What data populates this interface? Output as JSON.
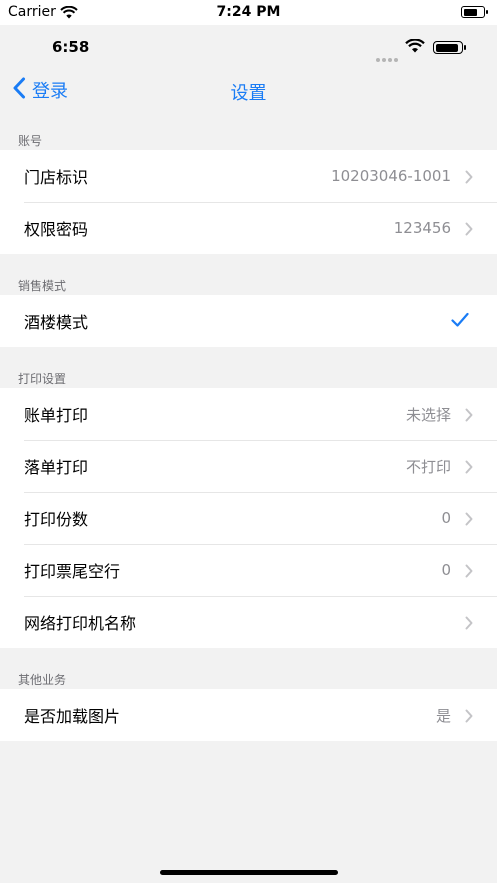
{
  "simulator_status": {
    "carrier": "Carrier",
    "time": "7:24 PM"
  },
  "device_status": {
    "time": "6:58"
  },
  "nav": {
    "back_label": "登录",
    "title": "设置"
  },
  "accent_color": "#1a7cf5",
  "sections": [
    {
      "header": "账号",
      "rows": [
        {
          "label": "门店标识",
          "value": "10203046-1001",
          "accessory": "chevron-icon"
        },
        {
          "label": "权限密码",
          "value": "123456",
          "accessory": "chevron-icon"
        }
      ]
    },
    {
      "header": "销售模式",
      "rows": [
        {
          "label": "酒楼模式",
          "value": "",
          "accessory": "checkmark-icon"
        }
      ]
    },
    {
      "header": "打印设置",
      "rows": [
        {
          "label": "账单打印",
          "value": "未选择",
          "accessory": "chevron-icon"
        },
        {
          "label": "落单打印",
          "value": "不打印",
          "accessory": "chevron-icon"
        },
        {
          "label": "打印份数",
          "value": "0",
          "accessory": "chevron-icon"
        },
        {
          "label": "打印票尾空行",
          "value": "0",
          "accessory": "chevron-icon"
        },
        {
          "label": "网络打印机名称",
          "value": "",
          "accessory": "chevron-icon"
        }
      ]
    },
    {
      "header": "其他业务",
      "rows": [
        {
          "label": "是否加载图片",
          "value": "是",
          "accessory": "chevron-icon"
        }
      ]
    }
  ]
}
